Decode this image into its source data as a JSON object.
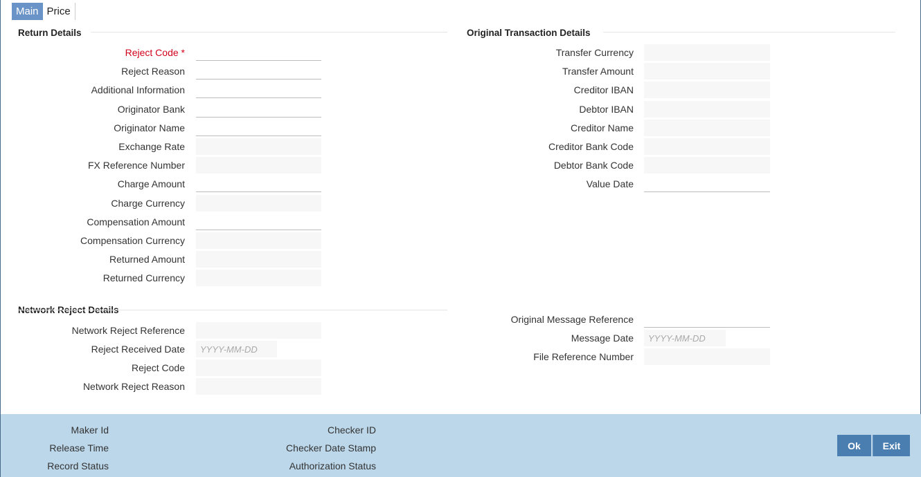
{
  "tabs": [
    "Main",
    "Price"
  ],
  "return_details": {
    "title": "Return Details",
    "fields": [
      {
        "label": "Reject Code",
        "value": "",
        "type": "edit",
        "required": true
      },
      {
        "label": "Reject Reason",
        "value": "",
        "type": "edit"
      },
      {
        "label": "Additional Information",
        "value": "",
        "type": "edit"
      },
      {
        "label": "Originator Bank",
        "value": "",
        "type": "edit"
      },
      {
        "label": "Originator Name",
        "value": "",
        "type": "edit"
      },
      {
        "label": "Exchange Rate",
        "value": "",
        "type": "ro"
      },
      {
        "label": "FX Reference Number",
        "value": "",
        "type": "ro"
      },
      {
        "label": "Charge Amount",
        "value": "",
        "type": "edit"
      },
      {
        "label": "Charge Currency",
        "value": "",
        "type": "ro"
      },
      {
        "label": "Compensation Amount",
        "value": "",
        "type": "edit"
      },
      {
        "label": "Compensation Currency",
        "value": "",
        "type": "ro"
      },
      {
        "label": "Returned Amount",
        "value": "",
        "type": "ro"
      },
      {
        "label": "Returned Currency",
        "value": "",
        "type": "ro"
      }
    ]
  },
  "original_transaction_details": {
    "title": "Original Transaction Details",
    "fields": [
      {
        "label": "Transfer Currency",
        "value": "",
        "type": "ro"
      },
      {
        "label": "Transfer Amount",
        "value": "",
        "type": "ro"
      },
      {
        "label": "Creditor IBAN",
        "value": "",
        "type": "ro"
      },
      {
        "label": "Debtor IBAN",
        "value": "",
        "type": "ro"
      },
      {
        "label": "Creditor Name",
        "value": "",
        "type": "ro"
      },
      {
        "label": "Creditor Bank Code",
        "value": "",
        "type": "ro"
      },
      {
        "label": "Debtor Bank Code",
        "value": "",
        "type": "ro"
      },
      {
        "label": "Value Date",
        "value": "",
        "type": "edit"
      }
    ]
  },
  "network_reject_details": {
    "title": "Network Reject Details",
    "fields": [
      {
        "label": "Network Reject Reference",
        "value": "",
        "type": "ro"
      },
      {
        "label": "Reject Received Date",
        "value": "",
        "type": "date",
        "placeholder": "YYYY-MM-DD"
      },
      {
        "label": "Reject Code",
        "value": "",
        "type": "ro"
      },
      {
        "label": "Network Reject Reason",
        "value": "",
        "type": "ro"
      }
    ]
  },
  "message_details": {
    "fields": [
      {
        "label": "Original Message Reference",
        "value": "",
        "type": "edit"
      },
      {
        "label": "Message Date",
        "value": "",
        "type": "date",
        "placeholder": "YYYY-MM-DD"
      },
      {
        "label": "File Reference Number",
        "value": "",
        "type": "ro"
      }
    ]
  },
  "footer": {
    "maker_id": "Maker Id",
    "release_time": "Release Time",
    "record_status": "Record Status",
    "checker_id": "Checker ID",
    "checker_date_stamp": "Checker Date Stamp",
    "authorization_status": "Authorization Status",
    "ok_label": "Ok",
    "exit_label": "Exit"
  },
  "colors": {
    "active_tab": "#6a94c8",
    "footer_bg": "#bcd7ea",
    "button_bg": "#4a7eb0",
    "required_label": "#d0021b"
  }
}
